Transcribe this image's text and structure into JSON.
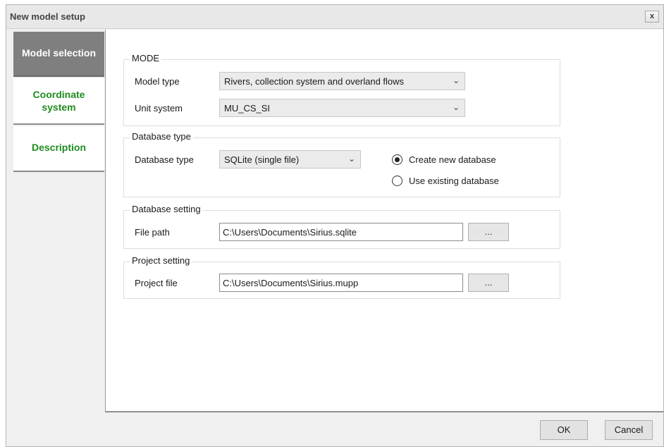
{
  "window": {
    "title": "New model setup",
    "close_label": "x"
  },
  "tabs": [
    {
      "label": "Model selection",
      "active": true
    },
    {
      "label": "Coordinate system",
      "active": false
    },
    {
      "label": "Description",
      "active": false
    }
  ],
  "mode": {
    "legend": "MODE",
    "model_type_label": "Model type",
    "model_type_value": "Rivers, collection system and overland flows",
    "unit_system_label": "Unit system",
    "unit_system_value": "MU_CS_SI"
  },
  "database_type": {
    "legend": "Database type",
    "label": "Database type",
    "value": "SQLite (single file)",
    "options": [
      {
        "label": "Create new database",
        "selected": true
      },
      {
        "label": "Use existing database",
        "selected": false
      }
    ]
  },
  "database_setting": {
    "legend": "Database setting",
    "file_path_label": "File path",
    "file_path_value": "C:\\Users\\Documents\\Sirius.sqlite",
    "browse_label": "..."
  },
  "project_setting": {
    "legend": "Project setting",
    "project_file_label": "Project file",
    "project_file_value": "C:\\Users\\Documents\\Sirius.mupp",
    "browse_label": "..."
  },
  "footer": {
    "ok_label": "OK",
    "cancel_label": "Cancel"
  }
}
